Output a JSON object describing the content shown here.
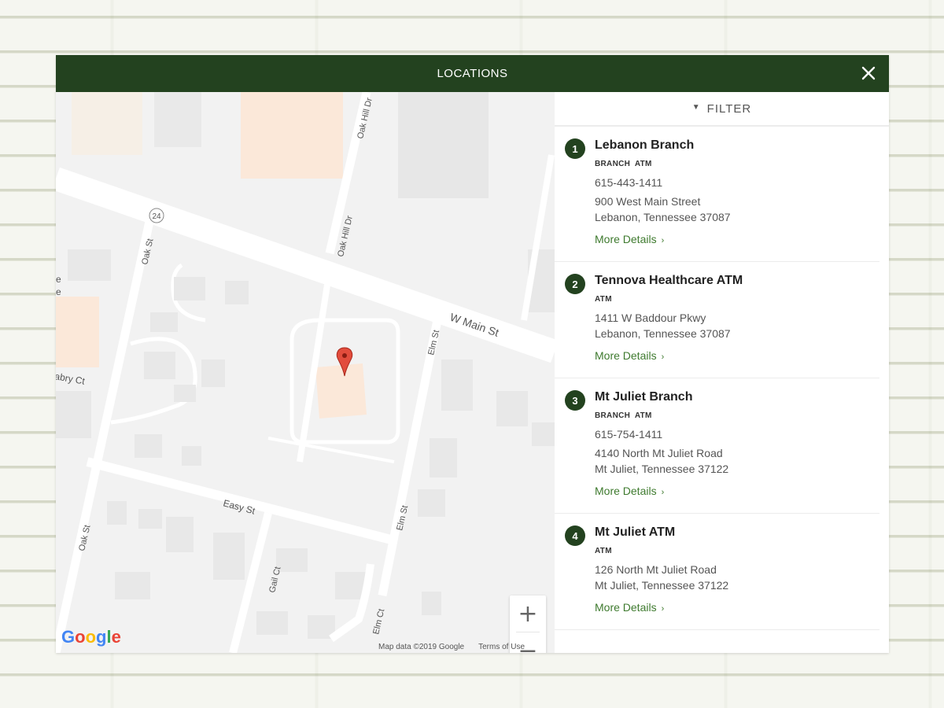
{
  "modal": {
    "title": "LOCATIONS"
  },
  "colors": {
    "header_bg": "#23421f",
    "link": "#3e7a2e",
    "pin": "#e24c3c"
  },
  "map": {
    "streets": [
      "W Main St",
      "Oak St",
      "Oak Hill Dr",
      "Elm St",
      "Easy St",
      "Gail Ct",
      "Elm Ct",
      "abry Ct"
    ],
    "route_badge": "24",
    "zoom_in": "+",
    "zoom_out": "−",
    "logo": "Google",
    "footer_data": "Map data ©2019 Google",
    "footer_terms": "Terms of Use",
    "edge_text_1": "e",
    "edge_text_2": "e"
  },
  "filter": {
    "label": "FILTER",
    "icon": "chevron-down-icon"
  },
  "locations": [
    {
      "num": "1",
      "name": "Lebanon Branch",
      "tags": "BRANCH ATM",
      "phone": "615-443-1411",
      "address_line1": "900 West Main Street",
      "address_line2": "Lebanon, Tennessee 37087",
      "more": "More Details"
    },
    {
      "num": "2",
      "name": "Tennova Healthcare ATM",
      "tags": "ATM",
      "phone": "",
      "address_line1": "1411 W Baddour Pkwy",
      "address_line2": "Lebanon, Tennessee 37087",
      "more": "More Details"
    },
    {
      "num": "3",
      "name": "Mt Juliet Branch",
      "tags": "BRANCH ATM",
      "phone": "615-754-1411",
      "address_line1": "4140 North Mt Juliet Road",
      "address_line2": "Mt Juliet, Tennessee 37122",
      "more": "More Details"
    },
    {
      "num": "4",
      "name": "Mt Juliet ATM",
      "tags": "ATM",
      "phone": "",
      "address_line1": "126 North Mt Juliet Road",
      "address_line2": "Mt Juliet, Tennessee 37122",
      "more": "More Details"
    }
  ]
}
